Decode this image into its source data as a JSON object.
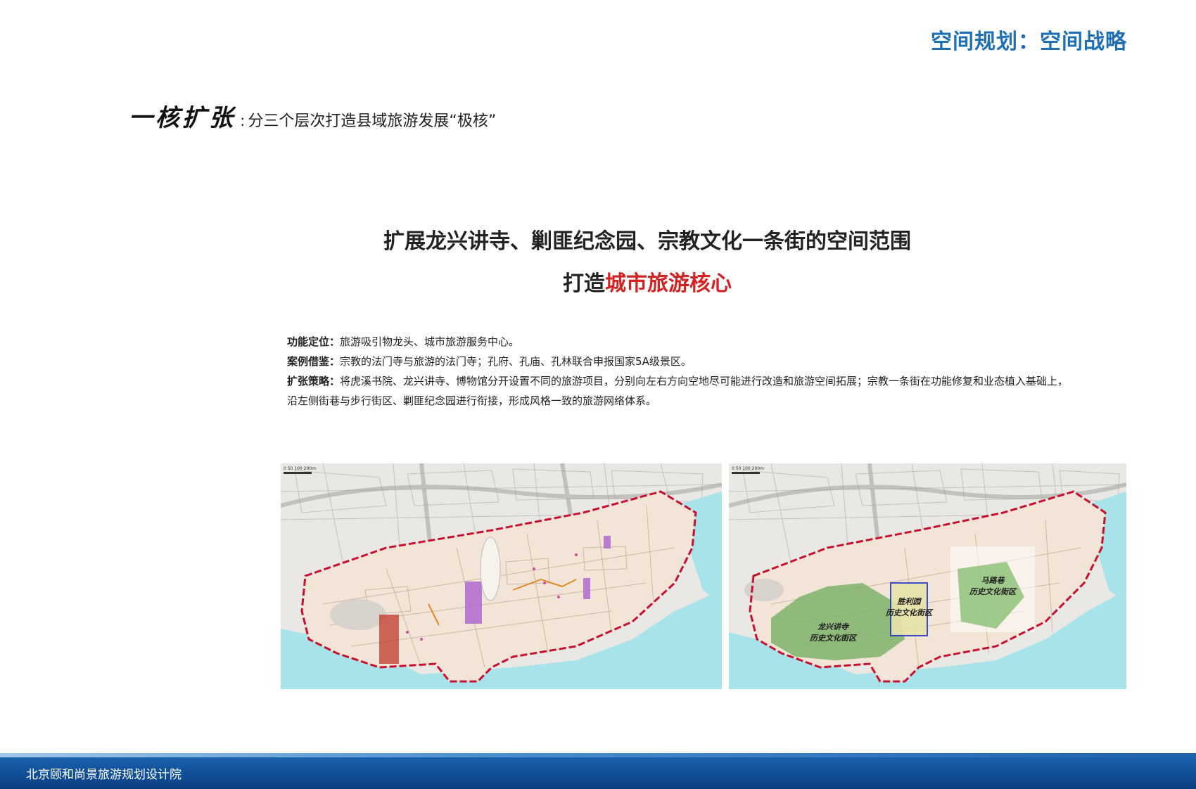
{
  "header": {
    "title": "空间规划：空间战略"
  },
  "section": {
    "title": "一核扩张",
    "colon": ":",
    "subtitle": "分三个层次打造县域旅游发展“极核”"
  },
  "headline": {
    "line1": "扩展龙兴讲寺、剿匪纪念园、宗教文化一条街的空间范围",
    "line2_prefix": "打造",
    "line2_highlight": "城市旅游核心"
  },
  "info": [
    {
      "label": "功能定位",
      "sep": "：",
      "text": "旅游吸引物龙头、城市旅游服务中心。"
    },
    {
      "label": "案例借鉴",
      "sep": "：",
      "text": "宗教的法门寺与旅游的法门寺；孔府、孔庙、孔林联合申报国家5A级景区。"
    },
    {
      "label": "扩张策略",
      "sep": "：",
      "text": "将虎溪书院、龙兴讲寺、博物馆分开设置不同的旅游项目，分别向左右方向空地尽可能进行改造和旅游空间拓展；宗教一条街在功能修复和业态植入基础上，"
    },
    {
      "label": "",
      "sep": "",
      "text": "沿左侧街巷与步行街区、剿匪纪念园进行衔接，形成风格一致的旅游网络体系。"
    }
  ],
  "maps": {
    "left": {
      "scale": "0   50  100    200m"
    },
    "right": {
      "scale": "0   50  100    200m",
      "zones": [
        {
          "line1": "龙兴讲寺",
          "line2": "历史文化街区"
        },
        {
          "line1": "胜利园",
          "line2": "历史文化街区"
        },
        {
          "line1": "马路巷",
          "line2": "历史文化街区"
        }
      ]
    }
  },
  "colors": {
    "accent": "#1f6fb5",
    "highlight": "#d42222",
    "boundary": "#c8102e",
    "water": "#a9e3ea",
    "footer": "#0f4d95"
  },
  "footer": {
    "org": "北京颐和尚景旅游规划设计院"
  }
}
